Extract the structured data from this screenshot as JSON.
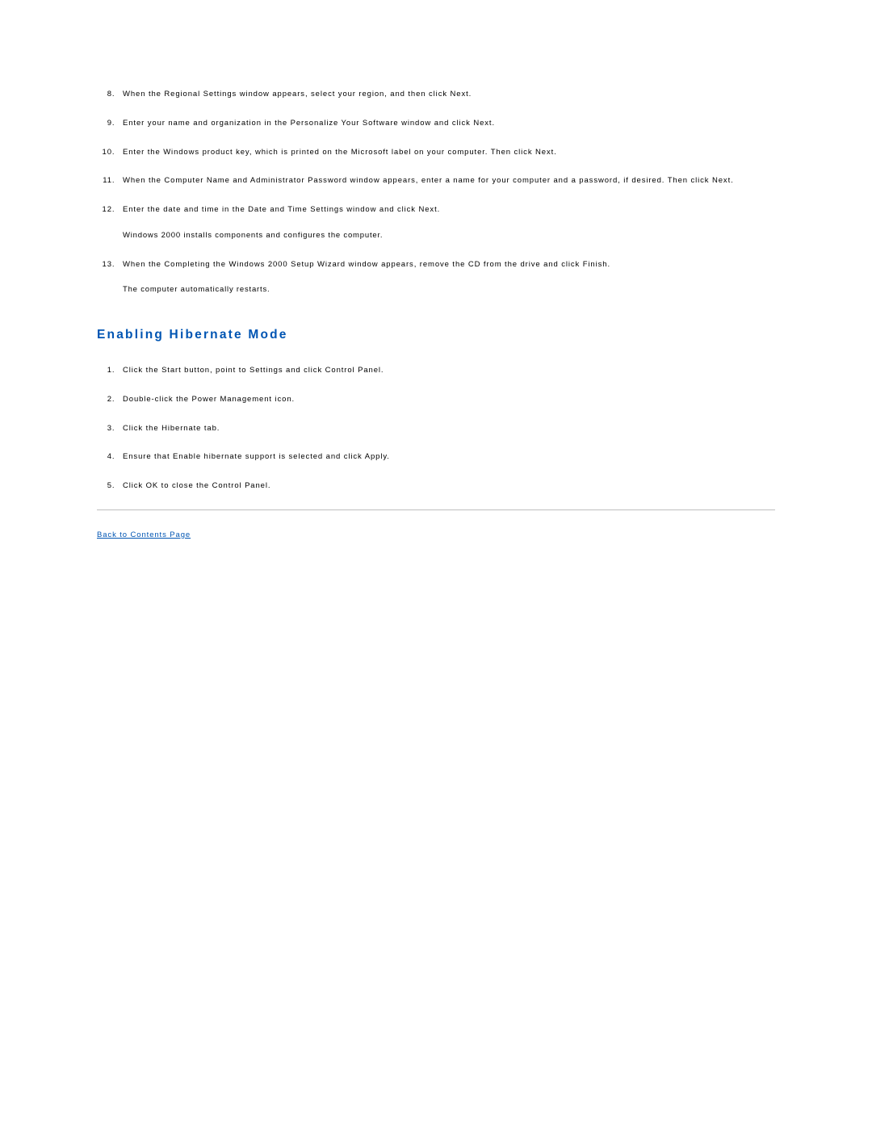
{
  "ol1_start": "8",
  "list1": [
    {
      "text": "When the Regional Settings window appears, select your region, and then click Next."
    },
    {
      "text": "Enter your name and organization in the Personalize Your Software window and click Next."
    },
    {
      "text": "Enter the Windows product key, which is printed on the Microsoft label on your computer. Then click Next."
    },
    {
      "text": "When the Computer Name and Administrator Password window appears, enter a name for your computer and a password, if desired. Then click Next."
    },
    {
      "text": "Enter the date and time in the Date and Time Settings window and click Next.",
      "sub": "Windows 2000 installs components and configures the computer."
    },
    {
      "text": "When the Completing the Windows 2000 Setup Wizard window appears, remove the CD from the drive and click Finish.",
      "sub": "The computer automatically restarts."
    }
  ],
  "section_heading": "Enabling Hibernate Mode",
  "list2": [
    {
      "text": "Click the Start button, point to Settings and click Control Panel."
    },
    {
      "text": "Double-click the Power Management icon."
    },
    {
      "text": "Click the Hibernate tab."
    },
    {
      "text": "Ensure that Enable hibernate support is selected and click Apply."
    },
    {
      "text": "Click OK to close the Control Panel."
    }
  ],
  "back_link": "Back to Contents Page"
}
